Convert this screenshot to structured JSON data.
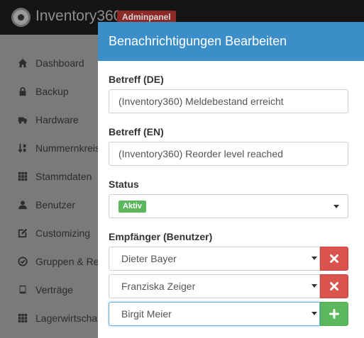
{
  "app": {
    "brand": "Inventory360",
    "badge": "Adminpanel"
  },
  "sidebar": {
    "items": [
      {
        "label": "Dashboard",
        "icon": "home-icon"
      },
      {
        "label": "Backup",
        "icon": "lock-icon"
      },
      {
        "label": "Hardware",
        "icon": "truck-icon"
      },
      {
        "label": "Nummernkreis",
        "icon": "sort-numeric-icon"
      },
      {
        "label": "Stammdaten",
        "icon": "grid-icon"
      },
      {
        "label": "Benutzer",
        "icon": "user-icon"
      },
      {
        "label": "Customizing",
        "icon": "edit-icon"
      },
      {
        "label": "Gruppen & Re",
        "icon": "check-circle-icon"
      },
      {
        "label": "Verträge",
        "icon": "book-icon"
      },
      {
        "label": "Lagerwirtscha",
        "icon": "grid-icon"
      }
    ]
  },
  "modal": {
    "title": "Benachrichtigungen Bearbeiten",
    "subject_de": {
      "label": "Betreff (DE)",
      "value": "(Inventory360) Meldebestand erreicht"
    },
    "subject_en": {
      "label": "Betreff (EN)",
      "value": "(Inventory360) Reorder level reached"
    },
    "status": {
      "label": "Status",
      "value": "Aktiv",
      "color": "#5cb85c"
    },
    "recipients": {
      "label": "Empfänger (Benutzer)",
      "items": [
        {
          "name": "Dieter Bayer",
          "action": "remove"
        },
        {
          "name": "Franziska Zeiger",
          "action": "remove"
        },
        {
          "name": "Birgit Meier",
          "action": "add"
        }
      ]
    }
  },
  "colors": {
    "header": "#3c8ec9",
    "remove": "#d9534f",
    "add": "#5cb85c",
    "badge": "#8d2a28"
  }
}
